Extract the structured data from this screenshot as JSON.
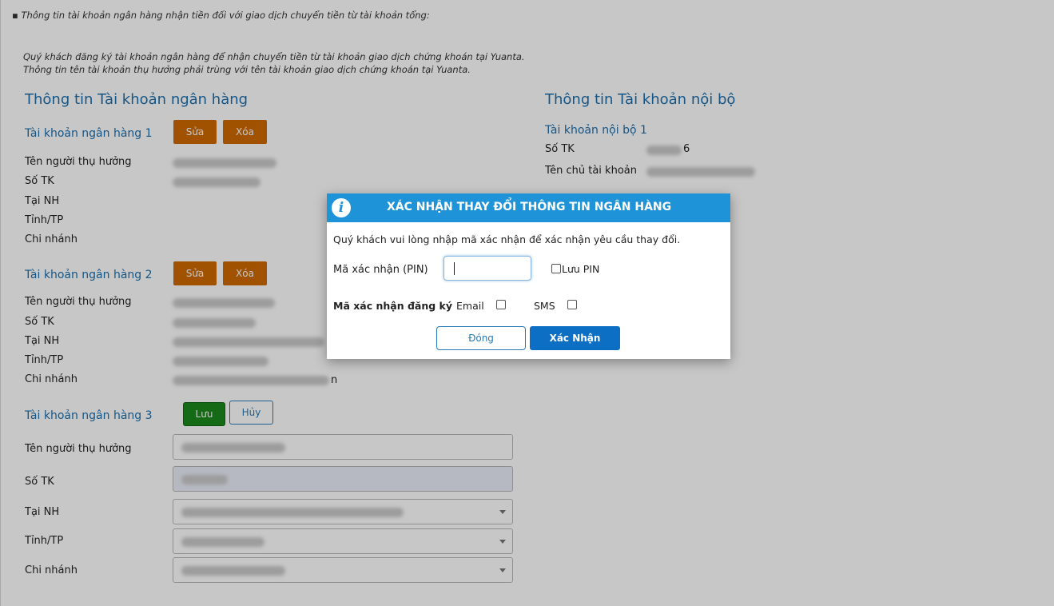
{
  "notes": {
    "line1": "Thông tin tài khoản ngân hàng nhận tiền đối với giao dịch chuyển tiền từ tài khoản tổng:",
    "line2": "Quý khách đăng ký tài khoản ngân hàng để nhận chuyển tiền từ tài khoản giao dịch chứng khoán tại Yuanta.",
    "line3": "Thông tin tên tài khoản thụ hưởng phải trùng với tên tài khoản giao dịch chứng khoán tại Yuanta."
  },
  "bank": {
    "title": "Thông tin Tài khoản ngân hàng",
    "account1": {
      "title": "Tài khoản ngân hàng 1",
      "edit_label": "Sửa",
      "delete_label": "Xóa",
      "fields": [
        "Tên người thụ hưởng",
        "Số TK",
        "Tại NH",
        "Tỉnh/TP",
        "Chi nhánh"
      ]
    },
    "account2": {
      "title": "Tài khoản ngân hàng 2",
      "edit_label": "Sửa",
      "delete_label": "Xóa",
      "fields": [
        "Tên người thụ hưởng",
        "Số TK",
        "Tại NH",
        "Tỉnh/TP",
        "Chi nhánh"
      ],
      "tail_text": "n"
    },
    "account3": {
      "title": "Tài khoản ngân hàng 3",
      "save_label": "Lưu",
      "cancel_label": "Hủy",
      "fields": [
        "Tên người thụ hưởng",
        "Số TK",
        "Tại NH",
        "Tỉnh/TP",
        "Chi nhánh"
      ]
    }
  },
  "internal": {
    "title": "Thông tin Tài khoản nội bộ",
    "account1": {
      "title": "Tài khoản nội bộ 1",
      "number_label": "Số TK",
      "number_tail": "6",
      "owner_label": "Tên chủ tài khoản"
    }
  },
  "dialog": {
    "title": "XÁC NHẬN THAY ĐỔI THÔNG TIN NGÂN HÀNG",
    "message": "Quý khách vui lòng nhập mã xác nhận để xác nhận yêu cầu thay đổi.",
    "pin_label": "Mã xác nhận (PIN)",
    "pin_value": "",
    "save_pin_label": "Lưu PIN",
    "register_label": "Mã xác nhận đăng ký",
    "email_label": "Email",
    "sms_label": "SMS",
    "close_label": "Đóng",
    "confirm_label": "Xác Nhận"
  },
  "colors": {
    "header_blue": "#1f93d8",
    "title_blue": "#1d6fae",
    "orange": "#cf6a00",
    "green": "#1c8a1c"
  }
}
